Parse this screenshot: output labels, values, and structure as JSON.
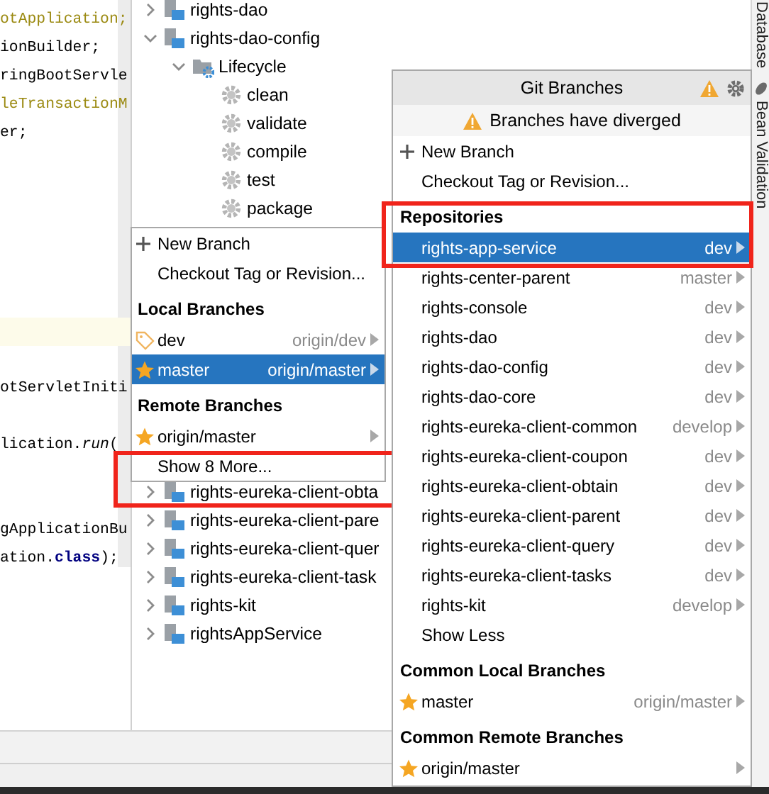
{
  "editor": {
    "lines": [
      {
        "kind": "code",
        "text": "otApplication;",
        "unused": true
      },
      {
        "kind": "code",
        "text": "ionBuilder;",
        "unused": false
      },
      {
        "kind": "code",
        "text": "ringBootServle",
        "unused": false
      },
      {
        "kind": "code",
        "text": "leTransactionM",
        "unused": true
      },
      {
        "kind": "code",
        "text": "er;",
        "unused": false
      },
      {
        "kind": "blank"
      },
      {
        "kind": "blank"
      },
      {
        "kind": "blank"
      },
      {
        "kind": "blank"
      },
      {
        "kind": "blank"
      },
      {
        "kind": "blank"
      },
      {
        "kind": "blank",
        "current": true
      },
      {
        "kind": "blank"
      },
      {
        "kind": "code",
        "text": "otServletIniti",
        "unused": false
      },
      {
        "kind": "blank"
      },
      {
        "kind": "code",
        "text": "lication.*run*(",
        "unused": false
      },
      {
        "kind": "blank"
      },
      {
        "kind": "blank"
      },
      {
        "kind": "code",
        "text": "gApplicationBu",
        "unused": false
      },
      {
        "kind": "code",
        "text": "ation.**class**);",
        "unused": false
      }
    ]
  },
  "tree": {
    "items": [
      {
        "kind": "module",
        "name": "rights-dao",
        "expanded": false
      },
      {
        "kind": "module",
        "name": "rights-dao-config",
        "expanded": true,
        "children": [
          {
            "kind": "folder",
            "name": "Lifecycle",
            "expanded": true,
            "children": [
              {
                "kind": "goal",
                "name": "clean"
              },
              {
                "kind": "goal",
                "name": "validate"
              },
              {
                "kind": "goal",
                "name": "compile"
              },
              {
                "kind": "goal",
                "name": "test"
              },
              {
                "kind": "goal",
                "name": "package"
              }
            ]
          }
        ]
      }
    ],
    "lower_items": [
      {
        "kind": "module",
        "name": "rights-eureka-client-obta",
        "expanded": false
      },
      {
        "kind": "module",
        "name": "rights-eureka-client-pare",
        "expanded": false
      },
      {
        "kind": "module",
        "name": "rights-eureka-client-quer",
        "expanded": false
      },
      {
        "kind": "module",
        "name": "rights-eureka-client-task",
        "expanded": false
      },
      {
        "kind": "module",
        "name": "rights-kit",
        "expanded": false
      },
      {
        "kind": "module",
        "name": "rightsAppService",
        "expanded": false
      }
    ]
  },
  "tool_strip": [
    {
      "label": "Database",
      "icon": false
    },
    {
      "label": "Bean Validation",
      "icon": true
    }
  ],
  "branch_popup": {
    "items": [
      {
        "kind": "create",
        "label": "New Branch",
        "annotated": false
      },
      {
        "kind": "action",
        "label": "Checkout Tag or Revision...",
        "annotated": false
      },
      {
        "kind": "header",
        "label": "Local Branches"
      },
      {
        "kind": "branch",
        "label": "dev",
        "favorite": false,
        "tracking": "origin/dev",
        "selected": false,
        "annotated": false
      },
      {
        "kind": "branch",
        "label": "master",
        "favorite": true,
        "tracking": "origin/master",
        "selected": true,
        "annotated": false
      },
      {
        "kind": "header",
        "label": "Remote Branches"
      },
      {
        "kind": "branch",
        "label": "origin/master",
        "favorite": true,
        "selected": false,
        "annotated": false
      },
      {
        "kind": "action",
        "label": "Show 8 More...",
        "annotated": true
      }
    ]
  },
  "git_branches": {
    "title": "Git Branches",
    "notice": "Branches have diverged",
    "items": [
      {
        "kind": "create",
        "label": "New Branch",
        "annotated": false
      },
      {
        "kind": "action",
        "label": "Checkout Tag or Revision...",
        "annotated": false
      },
      {
        "kind": "header",
        "label": "Repositories"
      },
      {
        "kind": "repo",
        "label": "rights-app-service",
        "tracking": "dev",
        "selected": true,
        "annotated": true
      },
      {
        "kind": "repo",
        "label": "rights-center-parent",
        "tracking": "master",
        "selected": false,
        "annotated": false
      },
      {
        "kind": "repo",
        "label": "rights-console",
        "tracking": "dev",
        "selected": false,
        "annotated": false
      },
      {
        "kind": "repo",
        "label": "rights-dao",
        "tracking": "dev",
        "selected": false,
        "annotated": false
      },
      {
        "kind": "repo",
        "label": "rights-dao-config",
        "tracking": "dev",
        "selected": false,
        "annotated": false
      },
      {
        "kind": "repo",
        "label": "rights-dao-core",
        "tracking": "dev",
        "selected": false,
        "annotated": false
      },
      {
        "kind": "repo",
        "label": "rights-eureka-client-common",
        "tracking": "develop",
        "selected": false,
        "annotated": false
      },
      {
        "kind": "repo",
        "label": "rights-eureka-client-coupon",
        "tracking": "dev",
        "selected": false,
        "annotated": false
      },
      {
        "kind": "repo",
        "label": "rights-eureka-client-obtain",
        "tracking": "dev",
        "selected": false,
        "annotated": false
      },
      {
        "kind": "repo",
        "label": "rights-eureka-client-parent",
        "tracking": "dev",
        "selected": false,
        "annotated": false
      },
      {
        "kind": "repo",
        "label": "rights-eureka-client-query",
        "tracking": "dev",
        "selected": false,
        "annotated": false
      },
      {
        "kind": "repo",
        "label": "rights-eureka-client-tasks",
        "tracking": "dev",
        "selected": false,
        "annotated": false
      },
      {
        "kind": "repo",
        "label": "rights-kit",
        "tracking": "develop",
        "selected": false,
        "annotated": false
      },
      {
        "kind": "action",
        "label": "Show Less",
        "annotated": false
      },
      {
        "kind": "header",
        "label": "Common Local Branches"
      },
      {
        "kind": "branch",
        "label": "master",
        "favorite": true,
        "tracking": "origin/master",
        "selected": false,
        "annotated": false
      },
      {
        "kind": "header",
        "label": "Common Remote Branches"
      },
      {
        "kind": "branch",
        "label": "origin/master",
        "favorite": true,
        "selected": false,
        "annotated": false
      }
    ]
  }
}
